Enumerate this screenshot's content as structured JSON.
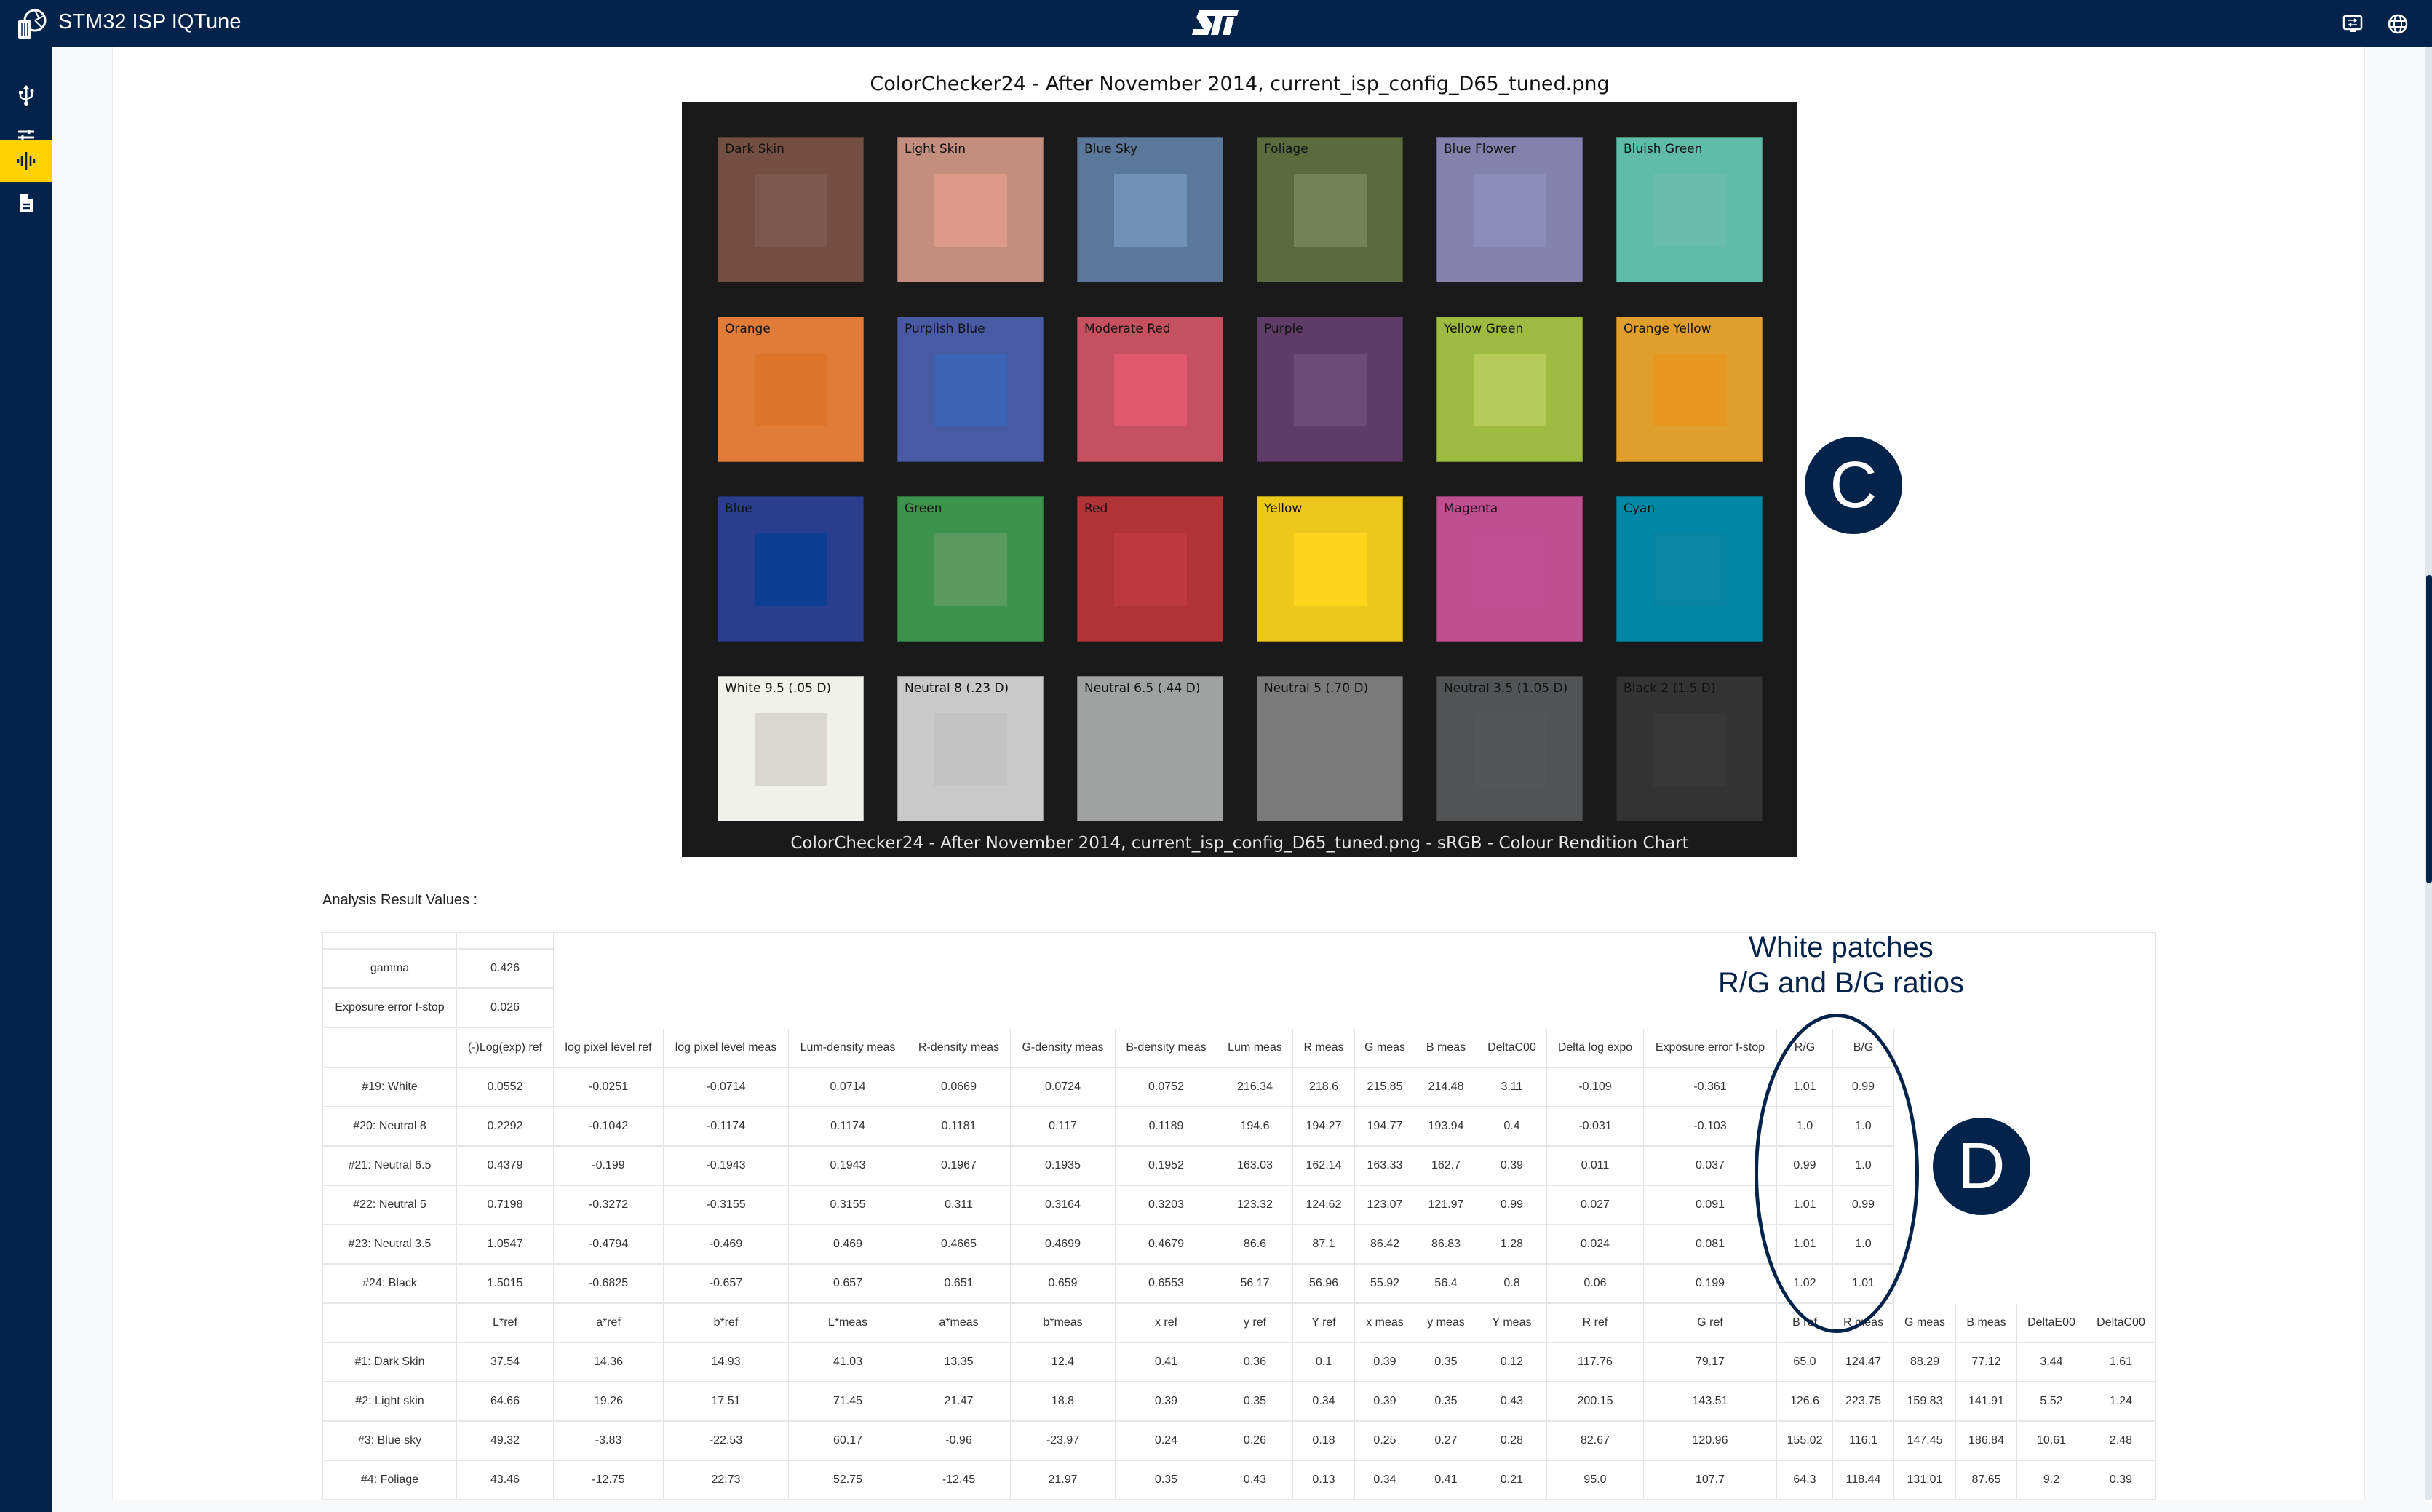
{
  "app": {
    "title": "STM32 ISP IQTune",
    "icons": {
      "logo": "camera-aperture-sliders-logo",
      "brand": "st-logo",
      "terminal": "terminal-icon",
      "language": "globe-icon"
    }
  },
  "sidebar": {
    "items": [
      {
        "name": "usb",
        "icon": "usb-icon",
        "active": false
      },
      {
        "name": "tuning",
        "icon": "sliders-icon",
        "active": false
      },
      {
        "name": "analysis",
        "icon": "waveform-icon",
        "active": true
      },
      {
        "name": "document",
        "icon": "document-icon",
        "active": false
      }
    ],
    "active_color": "#ffd200"
  },
  "chart": {
    "title": "ColorChecker24 - After November 2014, current_isp_config_D65_tuned.png",
    "caption": "ColorChecker24 - After November 2014, current_isp_config_D65_tuned.png - sRGB - Colour Rendition Chart",
    "patches": [
      {
        "label": "Dark Skin",
        "outer": "#734f42",
        "inner": "#7b5a4d"
      },
      {
        "label": "Light Skin",
        "outer": "#c48e7e",
        "inner": "#dc9b89"
      },
      {
        "label": "Blue Sky",
        "outer": "#5b7799",
        "inner": "#7191b7"
      },
      {
        "label": "Foliage",
        "outer": "#5c6b3e",
        "inner": "#748356"
      },
      {
        "label": "Blue Flower",
        "outer": "#8581ad",
        "inner": "#8c8cba"
      },
      {
        "label": "Bluish Green",
        "outer": "#5ebca9",
        "inner": "#69bdaa"
      },
      {
        "label": "Orange",
        "outer": "#e17c38",
        "inner": "#de7429"
      },
      {
        "label": "Purplish Blue",
        "outer": "#485aa3",
        "inner": "#3c64b4"
      },
      {
        "label": "Moderate Red",
        "outer": "#c5505f",
        "inner": "#e0586c"
      },
      {
        "label": "Purple",
        "outer": "#5f3b68",
        "inner": "#6d4b76"
      },
      {
        "label": "Yellow Green",
        "outer": "#9cbb40",
        "inner": "#b6cb5a"
      },
      {
        "label": "Orange Yellow",
        "outer": "#e09f2c",
        "inner": "#e6971f"
      },
      {
        "label": "Blue",
        "outer": "#2a3d8e",
        "inner": "#0d3f91"
      },
      {
        "label": "Green",
        "outer": "#3c944c",
        "inner": "#5a9a5e"
      },
      {
        "label": "Red",
        "outer": "#b03337",
        "inner": "#bd393e"
      },
      {
        "label": "Yellow",
        "outer": "#ecc81d",
        "inner": "#fdd51a"
      },
      {
        "label": "Magenta",
        "outer": "#be4f91",
        "inner": "#c04f93"
      },
      {
        "label": "Cyan",
        "outer": "#0088a6",
        "inner": "#0a86a4"
      },
      {
        "label": "White 9.5 (.05 D)",
        "outer": "#f1f1ec",
        "inner": "#dad7d3"
      },
      {
        "label": "Neutral 8 (.23 D)",
        "outer": "#c9c9c9",
        "inner": "#c2c2c2"
      },
      {
        "label": "Neutral 6.5 (.44 D)",
        "outer": "#a0a2a1",
        "inner": "#a1a3a2"
      },
      {
        "label": "Neutral 5 (.70 D)",
        "outer": "#7a7a7a",
        "inner": "#7b7b7b"
      },
      {
        "label": "Neutral 3.5 (1.05 D)",
        "outer": "#525354",
        "inner": "#545556"
      },
      {
        "label": "Black 2 (1.5 D)",
        "outer": "#333333",
        "inner": "#383838"
      }
    ]
  },
  "markers": {
    "c": "C",
    "d": "D"
  },
  "annotation": {
    "line1": "White patches",
    "line2": "R/G and B/G ratios"
  },
  "analysis": {
    "label": "Analysis Result Values :",
    "summary": [
      {
        "name": "gamma",
        "value": "0.426"
      },
      {
        "name": "Exposure error f-stop",
        "value": "0.026"
      }
    ],
    "neutral_headers": [
      "",
      "(-)Log(exp) ref",
      "log pixel level ref",
      "log pixel level meas",
      "Lum-density meas",
      "R-density meas",
      "G-density meas",
      "B-density meas",
      "Lum meas",
      "R meas",
      "G meas",
      "B meas",
      "DeltaC00",
      "Delta log expo",
      "Exposure error f-stop",
      "R/G",
      "B/G"
    ],
    "neutral_rows": [
      [
        "#19: White",
        "0.0552",
        "-0.0251",
        "-0.0714",
        "0.0714",
        "0.0669",
        "0.0724",
        "0.0752",
        "216.34",
        "218.6",
        "215.85",
        "214.48",
        "3.11",
        "-0.109",
        "-0.361",
        "1.01",
        "0.99"
      ],
      [
        "#20: Neutral 8",
        "0.2292",
        "-0.1042",
        "-0.1174",
        "0.1174",
        "0.1181",
        "0.117",
        "0.1189",
        "194.6",
        "194.27",
        "194.77",
        "193.94",
        "0.4",
        "-0.031",
        "-0.103",
        "1.0",
        "1.0"
      ],
      [
        "#21: Neutral 6.5",
        "0.4379",
        "-0.199",
        "-0.1943",
        "0.1943",
        "0.1967",
        "0.1935",
        "0.1952",
        "163.03",
        "162.14",
        "163.33",
        "162.7",
        "0.39",
        "0.011",
        "0.037",
        "0.99",
        "1.0"
      ],
      [
        "#22: Neutral 5",
        "0.7198",
        "-0.3272",
        "-0.3155",
        "0.3155",
        "0.311",
        "0.3164",
        "0.3203",
        "123.32",
        "124.62",
        "123.07",
        "121.97",
        "0.99",
        "0.027",
        "0.091",
        "1.01",
        "0.99"
      ],
      [
        "#23: Neutral 3.5",
        "1.0547",
        "-0.4794",
        "-0.469",
        "0.469",
        "0.4665",
        "0.4699",
        "0.4679",
        "86.6",
        "87.1",
        "86.42",
        "86.83",
        "1.28",
        "0.024",
        "0.081",
        "1.01",
        "1.0"
      ],
      [
        "#24: Black",
        "1.5015",
        "-0.6825",
        "-0.657",
        "0.657",
        "0.651",
        "0.659",
        "0.6553",
        "56.17",
        "56.96",
        "55.92",
        "56.4",
        "0.8",
        "0.06",
        "0.199",
        "1.02",
        "1.01"
      ]
    ],
    "color_headers": [
      "",
      "L*ref",
      "a*ref",
      "b*ref",
      "L*meas",
      "a*meas",
      "b*meas",
      "x ref",
      "y ref",
      "Y ref",
      "x meas",
      "y meas",
      "Y meas",
      "R ref",
      "G ref",
      "B ref",
      "R meas",
      "G meas",
      "B meas",
      "DeltaE00",
      "DeltaC00"
    ],
    "color_rows": [
      [
        "#1: Dark Skin",
        "37.54",
        "14.36",
        "14.93",
        "41.03",
        "13.35",
        "12.4",
        "0.41",
        "0.36",
        "0.1",
        "0.39",
        "0.35",
        "0.12",
        "117.76",
        "79.17",
        "65.0",
        "124.47",
        "88.29",
        "77.12",
        "3.44",
        "1.61"
      ],
      [
        "#2: Light skin",
        "64.66",
        "19.26",
        "17.51",
        "71.45",
        "21.47",
        "18.8",
        "0.39",
        "0.35",
        "0.34",
        "0.39",
        "0.35",
        "0.43",
        "200.15",
        "143.51",
        "126.6",
        "223.75",
        "159.83",
        "141.91",
        "5.52",
        "1.24"
      ],
      [
        "#3: Blue sky",
        "49.32",
        "-3.83",
        "-22.53",
        "60.17",
        "-0.96",
        "-23.97",
        "0.24",
        "0.26",
        "0.18",
        "0.25",
        "0.27",
        "0.28",
        "82.67",
        "120.96",
        "155.02",
        "116.1",
        "147.45",
        "186.84",
        "10.61",
        "2.48"
      ],
      [
        "#4: Foliage",
        "43.46",
        "-12.75",
        "22.73",
        "52.75",
        "-12.45",
        "21.97",
        "0.35",
        "0.43",
        "0.13",
        "0.34",
        "0.41",
        "0.21",
        "95.0",
        "107.7",
        "64.3",
        "118.44",
        "131.01",
        "87.65",
        "9.2",
        "0.39"
      ]
    ]
  }
}
